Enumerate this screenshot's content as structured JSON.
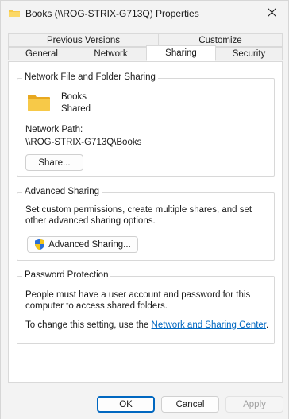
{
  "window": {
    "title": "Books (\\\\ROG-STRIX-G713Q) Properties"
  },
  "tabs": {
    "row_back": [
      "Previous Versions",
      "Customize"
    ],
    "row_front": [
      "General",
      "Network",
      "Sharing",
      "Security"
    ],
    "active": "Sharing"
  },
  "network_sharing": {
    "group_title": "Network File and Folder Sharing",
    "folder_name": "Books",
    "share_status": "Shared",
    "path_label": "Network Path:",
    "path_value": "\\\\ROG-STRIX-G713Q\\Books",
    "share_button": "Share..."
  },
  "advanced_sharing": {
    "group_title": "Advanced Sharing",
    "description": "Set custom permissions, create multiple shares, and set other advanced sharing options.",
    "button": "Advanced Sharing..."
  },
  "password_protection": {
    "group_title": "Password Protection",
    "description": "People must have a user account and password for this computer to access shared folders.",
    "change_prefix": "To change this setting, use the ",
    "link_text": "Network and Sharing Center",
    "change_suffix": "."
  },
  "footer": {
    "ok": "OK",
    "cancel": "Cancel",
    "apply": "Apply"
  },
  "colors": {
    "accent": "#0067c0",
    "folder": "#f7c948",
    "shield_blue": "#2b6fd6",
    "shield_yellow": "#f5c518"
  },
  "icons": {
    "title": "folder-icon",
    "close": "close-icon",
    "folder": "folder-icon",
    "shield": "uac-shield-icon"
  }
}
